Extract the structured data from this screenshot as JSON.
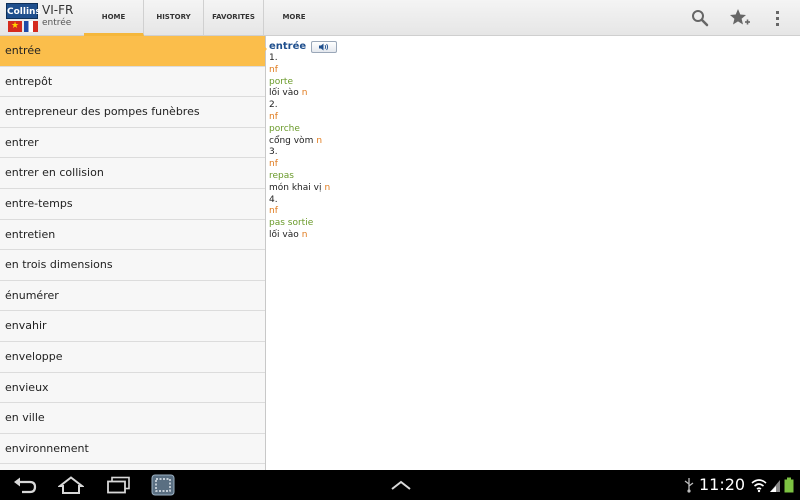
{
  "app": {
    "logo_text": "Collins",
    "title": "VI-FR",
    "subtitle": "entrée"
  },
  "tabs": [
    {
      "label": "HOME",
      "active": true
    },
    {
      "label": "HISTORY",
      "active": false
    },
    {
      "label": "FAVORITES",
      "active": false
    },
    {
      "label": "MORE",
      "active": false
    }
  ],
  "actions": {
    "icons": [
      "search-icon",
      "favorite-add-icon",
      "overflow-menu-icon"
    ]
  },
  "wordlist": {
    "items": [
      "entrée",
      "entrepôt",
      "entrepreneur des pompes funèbres",
      "entrer",
      "entrer en collision",
      "entre-temps",
      "entretien",
      "en trois dimensions",
      "énumérer",
      "envahir",
      "enveloppe",
      "envieux",
      "en ville",
      "environnement"
    ],
    "selected_index": 0
  },
  "entry": {
    "headword": "entrée",
    "audio_icon": "speaker-icon",
    "senses": [
      {
        "num": "1.",
        "pos": "nf",
        "fr": "porte",
        "vi": "lối vào",
        "vi_pos": "n"
      },
      {
        "num": "2.",
        "pos": "nf",
        "fr": "porche",
        "vi": "cổng vòm",
        "vi_pos": "n"
      },
      {
        "num": "3.",
        "pos": "nf",
        "fr": "repas",
        "vi": "món khai vị",
        "vi_pos": "n"
      },
      {
        "num": "4.",
        "pos": "nf",
        "fr": "pas sortie",
        "vi": "lối vào",
        "vi_pos": "n"
      }
    ]
  },
  "system_bar": {
    "time": "11:20",
    "nav_icons": [
      "back-icon",
      "home-icon",
      "recent-apps-icon",
      "screenshot-icon",
      "expand-up-icon"
    ],
    "status_icons": [
      "usb-icon",
      "wifi-icon",
      "signal-icon",
      "battery-icon"
    ]
  },
  "colors": {
    "accent": "#fbbe4b",
    "headword": "#1f4f8d",
    "pos": "#e07a1c",
    "french": "#6a9a2a"
  }
}
